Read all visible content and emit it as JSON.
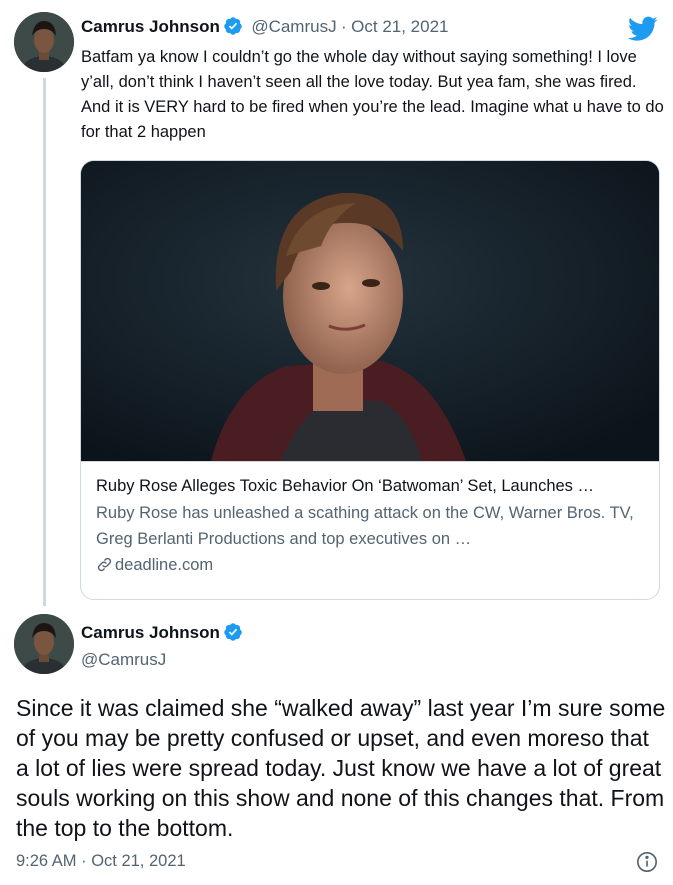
{
  "tweet1": {
    "author_name": "Camrus Johnson",
    "author_handle": "@CamrusJ",
    "separator": "·",
    "date": "Oct 21, 2021",
    "text": "Batfam ya know I couldn’t go the whole day without saying something! I love y’all, don’t think I haven’t seen all the love today. But yea fam, she was fired. And it is VERY hard to be fired when you’re the lead. Imagine what u have to do for that 2 happen",
    "card": {
      "title": "Ruby Rose Alleges Toxic Behavior On ‘Batwoman’ Set, Launches …",
      "description": "Ruby Rose has unleashed a scathing attack on the CW, Warner Bros. TV, Greg Berlanti Productions and top executives on …",
      "domain": "deadline.com"
    }
  },
  "tweet2": {
    "author_name": "Camrus Johnson",
    "author_handle": "@CamrusJ",
    "text": "Since it was claimed she “walked away” last year I’m sure some of you may be pretty confused or upset, and even moreso that a lot of lies were spread today. Just know we have a lot of great souls working on this show and none of this changes that. From the top to the bottom.",
    "timestamp": "9:26 AM · Oct 21, 2021"
  },
  "colors": {
    "verified": "#1d9bf0",
    "twitter_blue": "#1d9bf0",
    "secondary_text": "#536471",
    "border": "#cfd9de"
  },
  "icons": {
    "brand": "twitter-bird-icon",
    "verified": "verified-badge-icon",
    "link": "link-icon",
    "info": "info-icon"
  }
}
